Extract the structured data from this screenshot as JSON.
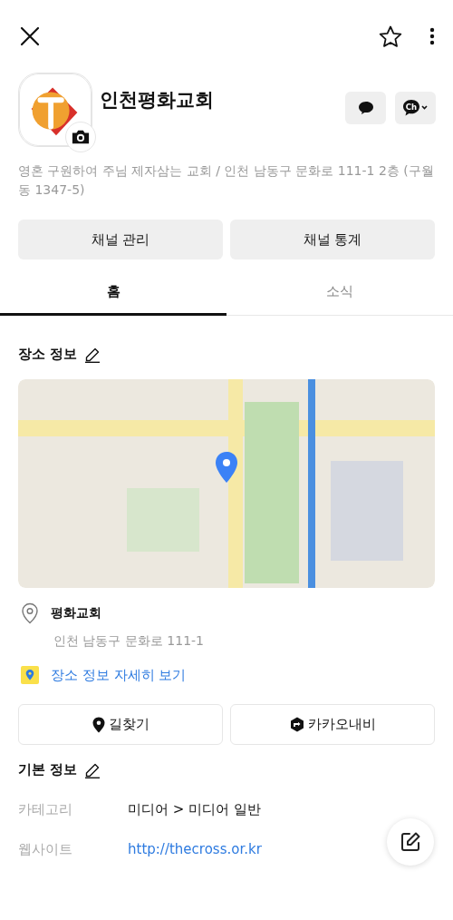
{
  "profile": {
    "name": "인천평화교회",
    "description": "영혼 구원하여 주님 제자삼는 교회 / 인천 남동구 문화로 111-1 2층 (구월동 1347-5)",
    "channel_icon_label": "Ch"
  },
  "admin_buttons": [
    "채널 관리",
    "채널 통계"
  ],
  "tabs": [
    {
      "label": "홈",
      "selected": true
    },
    {
      "label": "소식",
      "selected": false
    }
  ],
  "place_info": {
    "title": "장소 정보",
    "place_name": "평화교회",
    "address": "인천 남동구 문화로 111-1",
    "detail_link": "장소 정보 자세히 보기",
    "actions": [
      {
        "kind": "directions",
        "label": "길찾기"
      },
      {
        "kind": "navi",
        "label": "카카오내비"
      }
    ]
  },
  "basic_info": {
    "title": "기본 정보",
    "rows": [
      {
        "kind": "text",
        "label": "카테고리",
        "value": "미디어 > 미디어 일반"
      },
      {
        "kind": "link",
        "label": "웹사이트",
        "value": "http://thecross.or.kr"
      }
    ]
  }
}
